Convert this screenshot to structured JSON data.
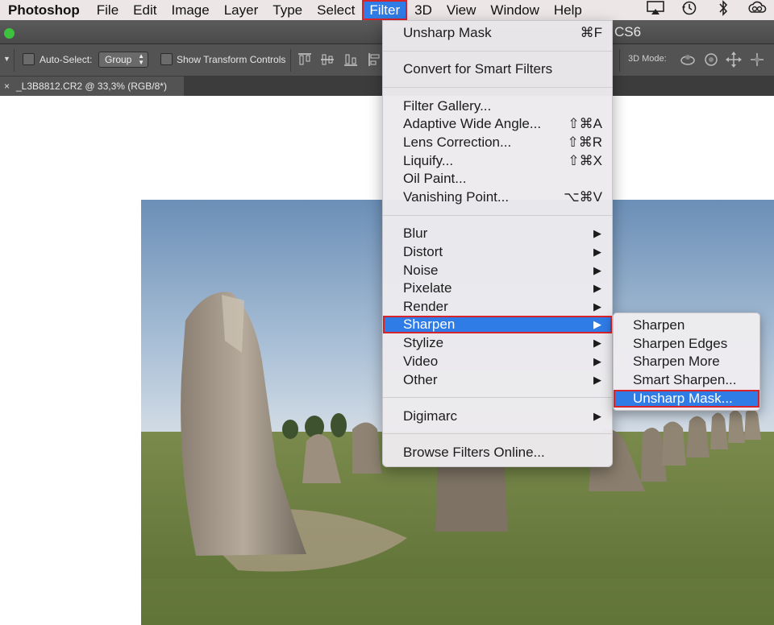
{
  "menubar": {
    "app_name": "Photoshop",
    "items": [
      "File",
      "Edit",
      "Image",
      "Layer",
      "Type",
      "Select",
      "Filter",
      "3D",
      "View",
      "Window",
      "Help"
    ],
    "active_item": "Filter",
    "status_icons": [
      "airplay-icon",
      "time-machine-icon",
      "bluetooth-icon",
      "creative-cloud-icon"
    ]
  },
  "window": {
    "title_fragment": "CS6"
  },
  "options_bar": {
    "auto_select_label": "Auto-Select:",
    "auto_select_value": "Group",
    "show_transform_label": "Show Transform Controls",
    "three_d_mode_label": "3D Mode:"
  },
  "document_tab": {
    "close_glyph": "×",
    "name": "_L3B8812.CR2 @ 33,3% (RGB/8*)"
  },
  "filter_menu": {
    "items": [
      {
        "label": "Unsharp Mask",
        "shortcut": "⌘F"
      },
      {
        "label": "Convert for Smart Filters"
      },
      {
        "label": "Filter Gallery..."
      },
      {
        "label": "Adaptive Wide Angle...",
        "shortcut": "⇧⌘A"
      },
      {
        "label": "Lens Correction...",
        "shortcut": "⇧⌘R"
      },
      {
        "label": "Liquify...",
        "shortcut": "⇧⌘X"
      },
      {
        "label": "Oil Paint..."
      },
      {
        "label": "Vanishing Point...",
        "shortcut": "⌥⌘V"
      },
      {
        "label": "Blur",
        "submenu": true
      },
      {
        "label": "Distort",
        "submenu": true
      },
      {
        "label": "Noise",
        "submenu": true
      },
      {
        "label": "Pixelate",
        "submenu": true
      },
      {
        "label": "Render",
        "submenu": true
      },
      {
        "label": "Sharpen",
        "submenu": true,
        "highlighted": true
      },
      {
        "label": "Stylize",
        "submenu": true
      },
      {
        "label": "Video",
        "submenu": true
      },
      {
        "label": "Other",
        "submenu": true
      },
      {
        "label": "Digimarc",
        "submenu": true
      },
      {
        "label": "Browse Filters Online..."
      }
    ],
    "arrow_glyph": "▶"
  },
  "sharpen_submenu": {
    "items": [
      {
        "label": "Sharpen"
      },
      {
        "label": "Sharpen Edges"
      },
      {
        "label": "Sharpen More"
      },
      {
        "label": "Smart Sharpen..."
      },
      {
        "label": "Unsharp Mask...",
        "highlighted": true
      }
    ]
  },
  "colors": {
    "menu_highlight": "#2f7ce6",
    "annotation_outline": "#d8232a",
    "toolbar_gray": "#535353"
  }
}
